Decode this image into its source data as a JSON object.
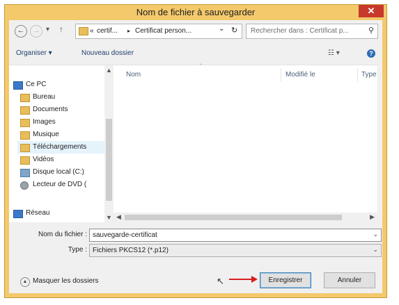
{
  "window": {
    "title": "Nom de fichier à sauvegarder",
    "close_glyph": "✕"
  },
  "nav": {
    "back_icon": "arrow-left-icon",
    "forward_icon": "arrow-right-icon",
    "recent_icon": "chevron-down-icon",
    "up_icon": "arrow-up-icon",
    "breadcrumb_prefix": "«",
    "breadcrumb_1": "certif...",
    "breadcrumb_sep": "▸",
    "breadcrumb_2": "Certificat person...",
    "address_dropdown": "⌄",
    "refresh_glyph": "↻",
    "search_placeholder": "Rechercher dans : Certificat p...",
    "search_glyph": "⚲"
  },
  "toolbar": {
    "organise_label": "Organiser ▾",
    "new_folder_label": "Nouveau dossier",
    "view_glyph": "☷ ▾",
    "help_glyph": "?"
  },
  "tree": {
    "items": [
      {
        "label": "Ce PC",
        "icon": "computer-icon"
      },
      {
        "label": "Bureau",
        "icon": "desktop-folder-icon"
      },
      {
        "label": "Documents",
        "icon": "documents-folder-icon"
      },
      {
        "label": "Images",
        "icon": "pictures-folder-icon"
      },
      {
        "label": "Musique",
        "icon": "music-folder-icon"
      },
      {
        "label": "Téléchargements",
        "icon": "downloads-folder-icon"
      },
      {
        "label": "Vidéos",
        "icon": "videos-folder-icon"
      },
      {
        "label": "Disque local (C:)",
        "icon": "hard-drive-icon"
      },
      {
        "label": "Lecteur de DVD (",
        "icon": "dvd-drive-icon"
      },
      {
        "label": "Réseau",
        "icon": "network-icon"
      }
    ]
  },
  "columns": {
    "name": "Nom",
    "modified": "Modifié le",
    "type": "Type"
  },
  "form": {
    "filename_label": "Nom du fichier :",
    "filename_value": "sauvegarde-certificat",
    "type_label": "Type :",
    "type_value": "Fichiers PKCS12 (*.p12)"
  },
  "footer": {
    "hide_folders_label": "Masquer les dossiers",
    "save_label": "Enregistrer",
    "cancel_label": "Annuler"
  },
  "colors": {
    "title_bar": "#f3c96b",
    "close_button": "#c7392b",
    "annotation_arrow": "#d91c1c"
  }
}
